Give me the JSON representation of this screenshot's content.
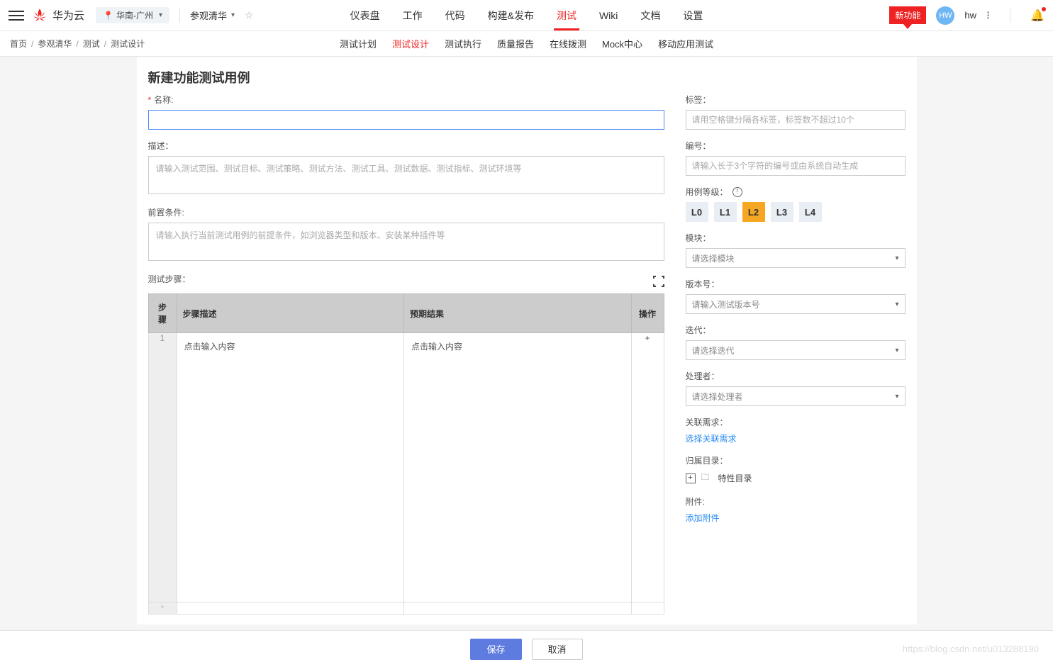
{
  "header": {
    "brand_text": "华为云",
    "region": "华南-广州",
    "project": "参观清华",
    "new_feature_tag": "新功能",
    "avatar_initials": "HW",
    "user_name": "hw"
  },
  "nav_primary": [
    "仪表盘",
    "工作",
    "代码",
    "构建&发布",
    "测试",
    "Wiki",
    "文档",
    "设置"
  ],
  "nav_primary_active": 4,
  "breadcrumb": [
    "首页",
    "参观清华",
    "测试",
    "测试设计"
  ],
  "subnav": [
    "测试计划",
    "测试设计",
    "测试执行",
    "质量报告",
    "在线拨测",
    "Mock中心",
    "移动应用测试"
  ],
  "subnav_active": 1,
  "page": {
    "title": "新建功能测试用例",
    "name_label": "名称:",
    "desc_label": "描述：",
    "desc_placeholder": "请输入测试范围、测试目标、测试策略、测试方法、测试工具、测试数据、测试指标、测试环境等",
    "precond_label": "前置条件:",
    "precond_placeholder": "请输入执行当前测试用例的前提条件，如浏览器类型和版本、安装某种插件等",
    "steps_label": "测试步骤：",
    "steps_table": {
      "headers": [
        "步骤",
        "步骤描述",
        "预期结果",
        "操作"
      ],
      "cell_placeholder": "点击输入内容",
      "step_number": "1"
    }
  },
  "side": {
    "tags_label": "标签：",
    "tags_placeholder": "请用空格键分隔各标签，标签数不超过10个",
    "number_label": "编号：",
    "number_placeholder": "请输入长于3个字符的编号或由系统自动生成",
    "level_label": "用例等级：",
    "levels": [
      "L0",
      "L1",
      "L2",
      "L3",
      "L4"
    ],
    "level_active": 2,
    "module_label": "模块：",
    "module_placeholder": "请选择模块",
    "version_label": "版本号：",
    "version_placeholder": "请输入测试版本号",
    "iteration_label": "迭代：",
    "iteration_placeholder": "请选择迭代",
    "owner_label": "处理者：",
    "owner_placeholder": "请选择处理者",
    "req_label": "关联需求：",
    "req_link": "选择关联需求",
    "dir_label": "归属目录：",
    "dir_value": "特性目录",
    "attach_label": "附件:",
    "attach_link": "添加附件"
  },
  "footer": {
    "save": "保存",
    "cancel": "取消"
  },
  "watermark": "https://blog.csdn.net/u013288190"
}
